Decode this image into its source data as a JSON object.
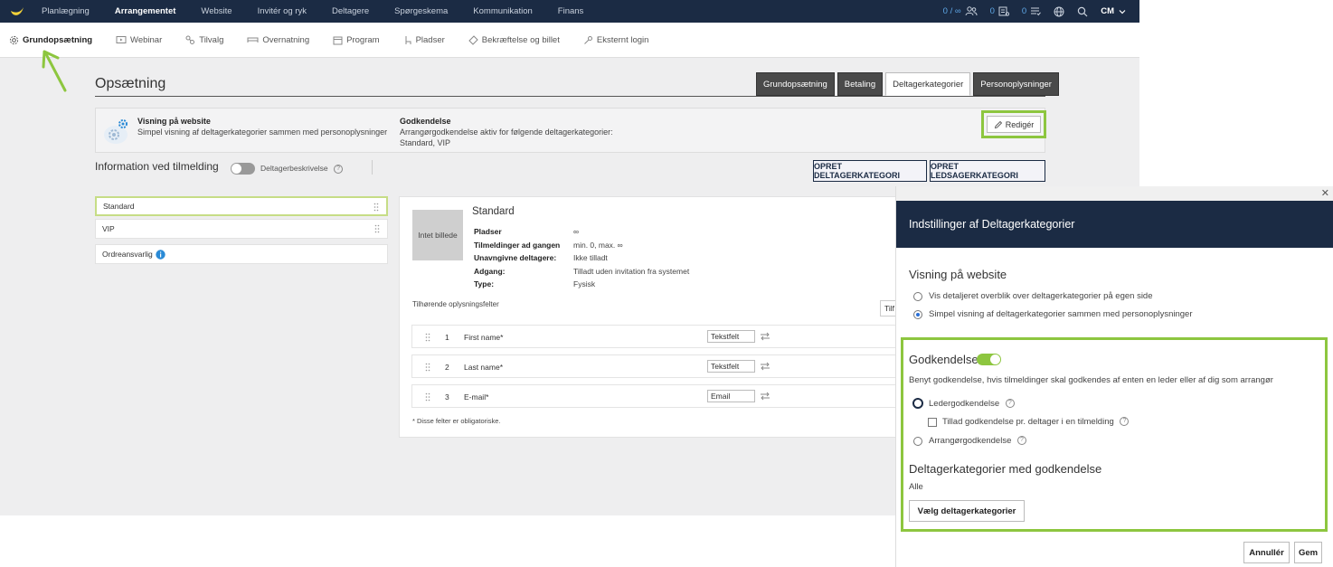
{
  "topnav": {
    "items": [
      "Planlægning",
      "Arrangementet",
      "Website",
      "Invitér og ryk",
      "Deltagere",
      "Spørgeskema",
      "Kommunikation",
      "Finans"
    ],
    "active_index": 1,
    "counters": [
      "0 / ∞",
      "0",
      "0"
    ],
    "user": "CM"
  },
  "subnav": {
    "items": [
      "Grundopsætning",
      "Webinar",
      "Tilvalg",
      "Overnatning",
      "Program",
      "Pladser",
      "Bekræftelse og billet",
      "Eksternt login"
    ],
    "active_index": 0
  },
  "page": {
    "title": "Opsætning",
    "tabs": [
      "Grundopsætning",
      "Betaling",
      "Deltagerkategorier",
      "Personoplysninger"
    ],
    "active_tab_index": 2
  },
  "website_panel": {
    "heading": "Visning på website",
    "text": "Simpel visning af deltagerkategorier sammen med personoplysninger",
    "approval_heading": "Godkendelse",
    "approval_text": "Arrangørgodkendelse aktiv for følgende deltagerkategorier:",
    "approval_categories": "Standard, VIP",
    "edit_label": "Redigér"
  },
  "info": {
    "title": "Information ved tilmelding",
    "toggle_label": "Deltagerbeskrivelse",
    "create_category": "OPRET DELTAGERKATEGORI",
    "create_companion": "OPRET LEDSAGERKATEGORI"
  },
  "categories": [
    {
      "label": "Standard"
    },
    {
      "label": "VIP"
    },
    {
      "label": "Ordreansvarlig"
    }
  ],
  "detail": {
    "no_image": "Intet billede",
    "title": "Standard",
    "rows": [
      {
        "key": "Pladser",
        "value": "∞"
      },
      {
        "key": "Tilmeldinger ad gangen",
        "value": "min. 0, max. ∞"
      },
      {
        "key": "Unavngivne deltagere:",
        "value": "Ikke tilladt"
      },
      {
        "key": "Adgang:",
        "value": "Tilladt uden invitation fra systemet"
      },
      {
        "key": "Type:",
        "value": "Fysisk"
      }
    ],
    "fields_title": "Tilhørende oplysningsfelter",
    "add_label": "Tilf",
    "fields": [
      {
        "num": "1",
        "name": "First name*",
        "type": "Tekstfelt"
      },
      {
        "num": "2",
        "name": "Last name*",
        "type": "Tekstfelt"
      },
      {
        "num": "3",
        "name": "E-mail*",
        "type": "Email"
      }
    ],
    "note": "* Disse felter er obligatoriske."
  },
  "modal": {
    "title": "Indstillinger af Deltagerkategorier",
    "website_heading": "Visning på website",
    "website_options": [
      "Vis detaljeret overblik over deltagerkategorier på egen side",
      "Simpel visning af deltagerkategorier sammen med personoplysninger"
    ],
    "website_selected": 1,
    "approval_heading": "Godkendelse",
    "approval_enabled": true,
    "approval_text": "Benyt godkendelse, hvis tilmeldinger skal godkendes af enten en leder eller af dig som arrangør",
    "leader_option": "Ledergodkendelse",
    "per_participant_option": "Tillad godkendelse pr. deltager i en tilmelding",
    "organizer_option": "Arrangørgodkendelse",
    "categories_heading": "Deltagerkategorier med godkendelse",
    "categories_value": "Alle",
    "choose_button": "Vælg deltagerkategorier",
    "cancel_button": "Annullér",
    "save_button": "Gem"
  },
  "colors": {
    "nav_bg": "#1b2b44",
    "accent_green": "#8dc63f",
    "link_blue": "#5fa8e8"
  }
}
